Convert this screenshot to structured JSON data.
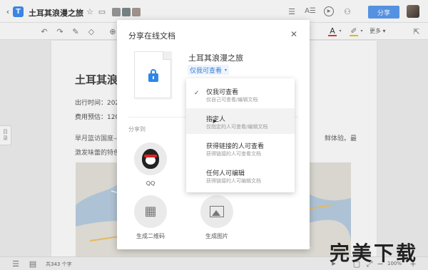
{
  "header": {
    "title": "土耳其浪漫之旅",
    "share_label": "分享"
  },
  "toolbar": {
    "more_label": "更多"
  },
  "document": {
    "title": "土耳其浪",
    "line1": "出行时间：202",
    "line2": "费用预估：120",
    "para1_left": "旱月篮访国度—",
    "para1_right": "鲜体验。最",
    "para2": "激发味蕾的特色"
  },
  "side_tab": {
    "label_top": "目",
    "label_bottom": "录"
  },
  "dialog": {
    "title": "分享在线文档",
    "doc_name": "土耳其浪漫之旅",
    "permission_selected": "仅我可查看",
    "share_to_label": "分享到",
    "targets": [
      {
        "label": "QQ"
      },
      {
        "label": "生成二维码"
      },
      {
        "label": "生成图片"
      }
    ]
  },
  "permission_menu": {
    "items": [
      {
        "title": "仅我可查看",
        "desc": "仅自己可查看/编辑文档",
        "checked": true
      },
      {
        "title": "指定人",
        "desc": "仅指定的人可查看/编辑文档",
        "checked": false
      },
      {
        "title": "获得链接的人可查看",
        "desc": "获得链接的人可查看文档",
        "checked": false
      },
      {
        "title": "任何人可编辑",
        "desc": "获得链接的人可编辑文档",
        "checked": false
      }
    ]
  },
  "status": {
    "word_count": "共343 个字",
    "zoom": "100%"
  },
  "watermark": {
    "text": "完美下载"
  },
  "colors": {
    "accent": "#5b9bf0",
    "menu_hover": "#f2f2f2"
  }
}
